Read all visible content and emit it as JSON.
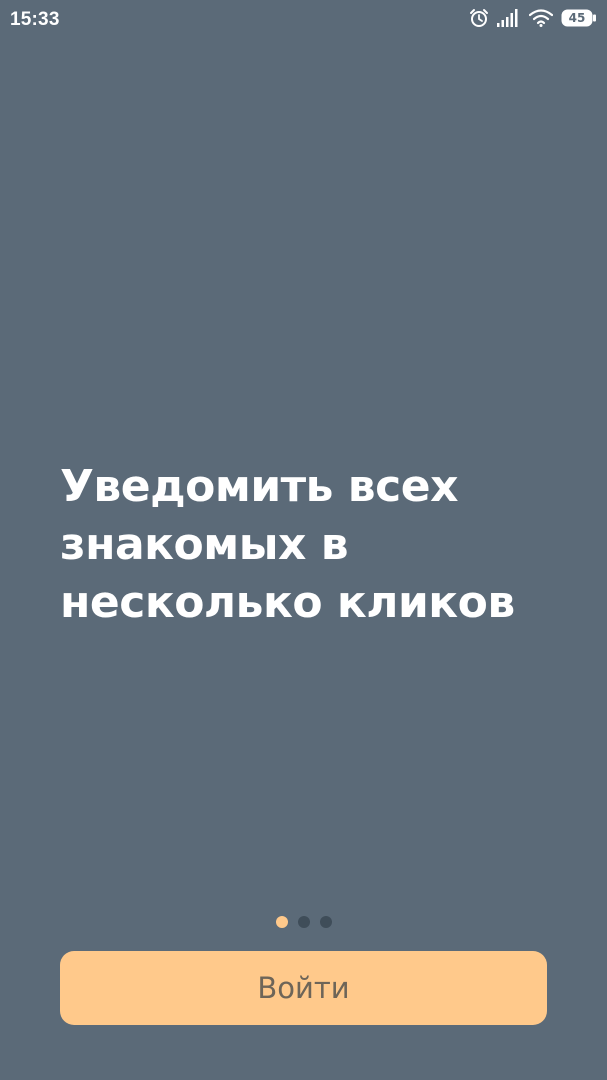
{
  "status_bar": {
    "time": "15:33",
    "battery_level": "45",
    "icons": [
      "alarm-icon",
      "signal-icon",
      "wifi-icon",
      "battery-icon"
    ]
  },
  "onboarding": {
    "headline_lines": [
      "Уведомить всех",
      "знакомых в",
      "несколько кликов"
    ],
    "page_count": 3,
    "active_page": 1
  },
  "login_button": {
    "label": "Войти"
  },
  "colors": {
    "background": "#5b6a78",
    "accent": "#ffc98b",
    "dot_inactive": "#3f4d59",
    "button_text": "#6e6558",
    "text": "#ffffff"
  }
}
